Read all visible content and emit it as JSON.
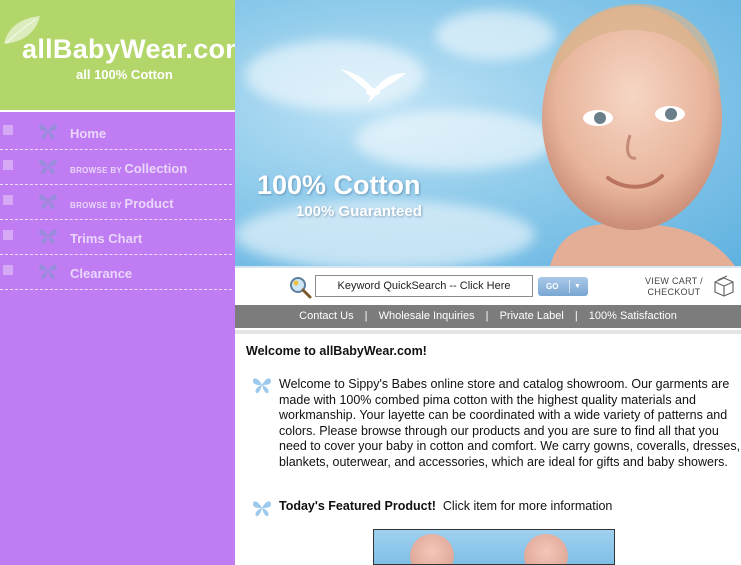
{
  "brand": {
    "name": "allBabyWear.com",
    "tagline": "all 100% Cotton"
  },
  "nav": {
    "items": [
      {
        "small": "",
        "label": "Home"
      },
      {
        "small": "BROWSE BY ",
        "label": "Collection"
      },
      {
        "small": "BROWSE BY ",
        "label": "Product"
      },
      {
        "small": "",
        "label": "Trims Chart"
      },
      {
        "small": "",
        "label": "Clearance"
      }
    ]
  },
  "banner": {
    "line1": "100% Cotton",
    "line2": "100% Guaranteed"
  },
  "search": {
    "value": "Keyword QuickSearch -- Click Here",
    "go_label": "GO",
    "go_arrow": "▼"
  },
  "cart": {
    "line1": "VIEW CART /",
    "line2": "CHECKOUT"
  },
  "links": {
    "items": [
      "Contact Us",
      "Wholesale Inquiries",
      "Private Label",
      "100% Satisfaction"
    ],
    "separator": "|"
  },
  "main": {
    "welcome_title": "Welcome to allBabyWear.com!",
    "intro": "Welcome to Sippy's Babes online store and catalog showroom. Our garments are made with 100% combed pima cotton with the highest quality materials and workmanship. Your layette can be coordinated with a wide variety of patterns and colors. Please browse through our products and you are sure to find all that you need to cover your baby in cotton and comfort. We carry gowns, coveralls, dresses, blankets, outerwear, and accessories, which are ideal for gifts and baby showers.",
    "featured_title": "Today's Featured Product!",
    "featured_text": "Click item for more information"
  },
  "icons": {
    "butterfly": "butterfly-icon",
    "search": "magnifier-icon",
    "cart": "shopping-box-icon"
  },
  "colors": {
    "sidebar": "#c07cf2",
    "logo_bg": "#b3d66b",
    "link_bar": "#7c7c7c",
    "go_button": "#7aa6d3",
    "butterfly": "#9cc9ec"
  }
}
